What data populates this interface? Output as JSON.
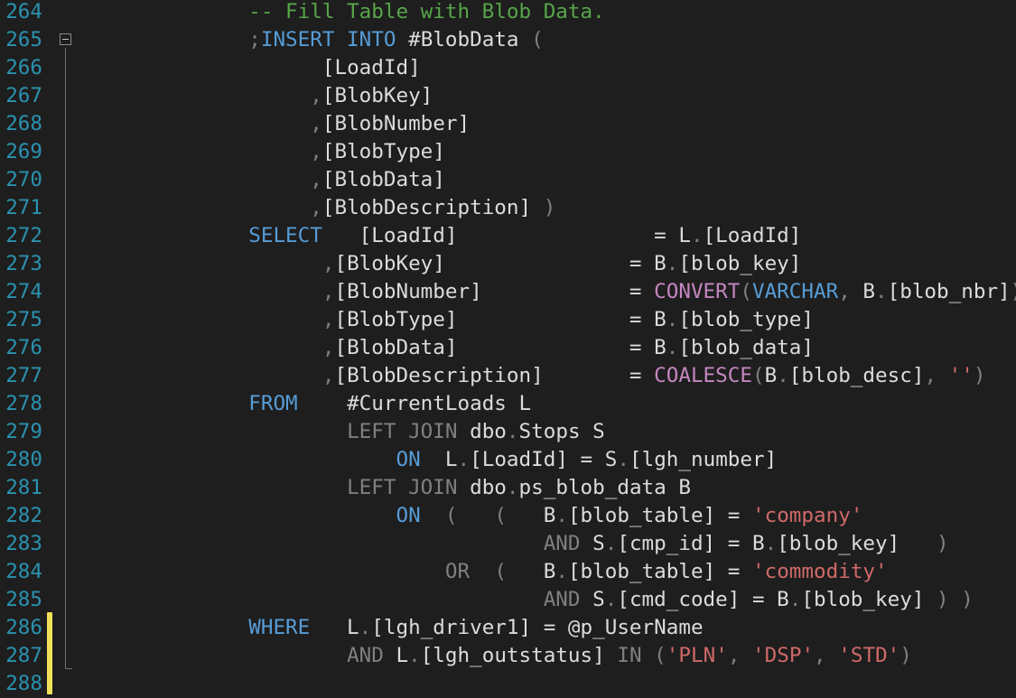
{
  "colors": {
    "background": "#1e1e1e",
    "line_number": "#2b91af",
    "keyword": "#569cd6",
    "keyword_gray": "#808080",
    "function": "#c586c0",
    "string": "#d16969",
    "comment": "#57a64a",
    "identifier": "#dcdcdc",
    "punctuation": "#808080",
    "change_bar": "#f2e05c"
  },
  "icons": {
    "fold": "collapse-minus-icon"
  },
  "lines": [
    {
      "num": "264",
      "tokens": [
        {
          "t": "            ",
          "k": "id"
        },
        {
          "t": "-- Fill Table with Blob Data.",
          "k": "cm"
        }
      ]
    },
    {
      "num": "265",
      "tokens": [
        {
          "t": "            ",
          "k": "id"
        },
        {
          "t": ";",
          "k": "pn"
        },
        {
          "t": "INSERT INTO",
          "k": "kw"
        },
        {
          "t": " #BlobData ",
          "k": "id"
        },
        {
          "t": "(",
          "k": "pn"
        }
      ]
    },
    {
      "num": "266",
      "tokens": [
        {
          "t": "                  ",
          "k": "id"
        },
        {
          "t": "[LoadId]",
          "k": "id"
        }
      ]
    },
    {
      "num": "267",
      "tokens": [
        {
          "t": "                 ",
          "k": "id"
        },
        {
          "t": ",",
          "k": "pn"
        },
        {
          "t": "[BlobKey]",
          "k": "id"
        }
      ]
    },
    {
      "num": "268",
      "tokens": [
        {
          "t": "                 ",
          "k": "id"
        },
        {
          "t": ",",
          "k": "pn"
        },
        {
          "t": "[BlobNumber]",
          "k": "id"
        }
      ]
    },
    {
      "num": "269",
      "tokens": [
        {
          "t": "                 ",
          "k": "id"
        },
        {
          "t": ",",
          "k": "pn"
        },
        {
          "t": "[BlobType]",
          "k": "id"
        }
      ]
    },
    {
      "num": "270",
      "tokens": [
        {
          "t": "                 ",
          "k": "id"
        },
        {
          "t": ",",
          "k": "pn"
        },
        {
          "t": "[BlobData]",
          "k": "id"
        }
      ]
    },
    {
      "num": "271",
      "tokens": [
        {
          "t": "                 ",
          "k": "id"
        },
        {
          "t": ",",
          "k": "pn"
        },
        {
          "t": "[BlobDescription] ",
          "k": "id"
        },
        {
          "t": ")",
          "k": "pn"
        }
      ]
    },
    {
      "num": "272",
      "tokens": [
        {
          "t": "            ",
          "k": "id"
        },
        {
          "t": "SELECT",
          "k": "kw"
        },
        {
          "t": "   [LoadId]                = ",
          "k": "id"
        },
        {
          "t": "L",
          "k": "id"
        },
        {
          "t": ".",
          "k": "pn"
        },
        {
          "t": "[LoadId]",
          "k": "id"
        }
      ]
    },
    {
      "num": "273",
      "tokens": [
        {
          "t": "                  ",
          "k": "id"
        },
        {
          "t": ",",
          "k": "pn"
        },
        {
          "t": "[BlobKey]               = B",
          "k": "id"
        },
        {
          "t": ".",
          "k": "pn"
        },
        {
          "t": "[blob_key]",
          "k": "id"
        }
      ]
    },
    {
      "num": "274",
      "tokens": [
        {
          "t": "                  ",
          "k": "id"
        },
        {
          "t": ",",
          "k": "pn"
        },
        {
          "t": "[BlobNumber]            = ",
          "k": "id"
        },
        {
          "t": "CONVERT",
          "k": "fn"
        },
        {
          "t": "(",
          "k": "pn"
        },
        {
          "t": "VARCHAR",
          "k": "kw"
        },
        {
          "t": ",",
          "k": "pn"
        },
        {
          "t": " B",
          "k": "id"
        },
        {
          "t": ".",
          "k": "pn"
        },
        {
          "t": "[blob_nbr]",
          "k": "id"
        },
        {
          "t": ")",
          "k": "pn"
        }
      ]
    },
    {
      "num": "275",
      "tokens": [
        {
          "t": "                  ",
          "k": "id"
        },
        {
          "t": ",",
          "k": "pn"
        },
        {
          "t": "[BlobType]              = B",
          "k": "id"
        },
        {
          "t": ".",
          "k": "pn"
        },
        {
          "t": "[blob_type]",
          "k": "id"
        }
      ]
    },
    {
      "num": "276",
      "tokens": [
        {
          "t": "                  ",
          "k": "id"
        },
        {
          "t": ",",
          "k": "pn"
        },
        {
          "t": "[BlobData]              = B",
          "k": "id"
        },
        {
          "t": ".",
          "k": "pn"
        },
        {
          "t": "[blob_data]",
          "k": "id"
        }
      ]
    },
    {
      "num": "277",
      "tokens": [
        {
          "t": "                  ",
          "k": "id"
        },
        {
          "t": ",",
          "k": "pn"
        },
        {
          "t": "[BlobDescription]       = ",
          "k": "id"
        },
        {
          "t": "COALESCE",
          "k": "fn"
        },
        {
          "t": "(",
          "k": "pn"
        },
        {
          "t": "B",
          "k": "id"
        },
        {
          "t": ".",
          "k": "pn"
        },
        {
          "t": "[blob_desc]",
          "k": "id"
        },
        {
          "t": ", ",
          "k": "pn"
        },
        {
          "t": "''",
          "k": "str"
        },
        {
          "t": ")",
          "k": "pn"
        }
      ]
    },
    {
      "num": "278",
      "tokens": [
        {
          "t": "            ",
          "k": "id"
        },
        {
          "t": "FROM",
          "k": "kw"
        },
        {
          "t": "    #CurrentLoads L",
          "k": "id"
        }
      ]
    },
    {
      "num": "279",
      "tokens": [
        {
          "t": "                    ",
          "k": "id"
        },
        {
          "t": "LEFT JOIN",
          "k": "kw2"
        },
        {
          "t": " dbo",
          "k": "id"
        },
        {
          "t": ".",
          "k": "pn"
        },
        {
          "t": "Stops S",
          "k": "id"
        }
      ]
    },
    {
      "num": "280",
      "tokens": [
        {
          "t": "                        ",
          "k": "id"
        },
        {
          "t": "ON",
          "k": "kw"
        },
        {
          "t": "  L",
          "k": "id"
        },
        {
          "t": ".",
          "k": "pn"
        },
        {
          "t": "[LoadId] ",
          "k": "id"
        },
        {
          "t": "=",
          "k": "id"
        },
        {
          "t": " S",
          "k": "id"
        },
        {
          "t": ".",
          "k": "pn"
        },
        {
          "t": "[lgh_number]",
          "k": "id"
        }
      ]
    },
    {
      "num": "281",
      "tokens": [
        {
          "t": "                    ",
          "k": "id"
        },
        {
          "t": "LEFT JOIN",
          "k": "kw2"
        },
        {
          "t": " dbo",
          "k": "id"
        },
        {
          "t": ".",
          "k": "pn"
        },
        {
          "t": "ps_blob_data B",
          "k": "id"
        }
      ]
    },
    {
      "num": "282",
      "tokens": [
        {
          "t": "                        ",
          "k": "id"
        },
        {
          "t": "ON",
          "k": "kw"
        },
        {
          "t": "  ",
          "k": "id"
        },
        {
          "t": "(   (",
          "k": "pn"
        },
        {
          "t": "   B",
          "k": "id"
        },
        {
          "t": ".",
          "k": "pn"
        },
        {
          "t": "[blob_table] = ",
          "k": "id"
        },
        {
          "t": "'company'",
          "k": "str"
        }
      ]
    },
    {
      "num": "283",
      "tokens": [
        {
          "t": "                                    ",
          "k": "id"
        },
        {
          "t": "AND",
          "k": "kw2"
        },
        {
          "t": " S",
          "k": "id"
        },
        {
          "t": ".",
          "k": "pn"
        },
        {
          "t": "[cmp_id] = B",
          "k": "id"
        },
        {
          "t": ".",
          "k": "pn"
        },
        {
          "t": "[blob_key]   ",
          "k": "id"
        },
        {
          "t": ")",
          "k": "pn"
        }
      ]
    },
    {
      "num": "284",
      "tokens": [
        {
          "t": "                            ",
          "k": "id"
        },
        {
          "t": "OR",
          "k": "kw2"
        },
        {
          "t": "  ",
          "k": "id"
        },
        {
          "t": "(",
          "k": "pn"
        },
        {
          "t": "   B",
          "k": "id"
        },
        {
          "t": ".",
          "k": "pn"
        },
        {
          "t": "[blob_table] = ",
          "k": "id"
        },
        {
          "t": "'commodity'",
          "k": "str"
        }
      ]
    },
    {
      "num": "285",
      "tokens": [
        {
          "t": "                                    ",
          "k": "id"
        },
        {
          "t": "AND",
          "k": "kw2"
        },
        {
          "t": " S",
          "k": "id"
        },
        {
          "t": ".",
          "k": "pn"
        },
        {
          "t": "[cmd_code] = B",
          "k": "id"
        },
        {
          "t": ".",
          "k": "pn"
        },
        {
          "t": "[blob_key] ",
          "k": "id"
        },
        {
          "t": ") )",
          "k": "pn"
        }
      ]
    },
    {
      "num": "286",
      "tokens": [
        {
          "t": "            ",
          "k": "id"
        },
        {
          "t": "WHERE",
          "k": "kw"
        },
        {
          "t": "   L",
          "k": "id"
        },
        {
          "t": ".",
          "k": "pn"
        },
        {
          "t": "[lgh_driver1] = @p_UserName",
          "k": "id"
        }
      ]
    },
    {
      "num": "287",
      "tokens": [
        {
          "t": "                    ",
          "k": "id"
        },
        {
          "t": "AND",
          "k": "kw2"
        },
        {
          "t": " L",
          "k": "id"
        },
        {
          "t": ".",
          "k": "pn"
        },
        {
          "t": "[lgh_outstatus] ",
          "k": "id"
        },
        {
          "t": "IN",
          "k": "kw2"
        },
        {
          "t": " (",
          "k": "pn"
        },
        {
          "t": "'PLN'",
          "k": "str"
        },
        {
          "t": ", ",
          "k": "pn"
        },
        {
          "t": "'DSP'",
          "k": "str"
        },
        {
          "t": ", ",
          "k": "pn"
        },
        {
          "t": "'STD'",
          "k": "str"
        },
        {
          "t": ")",
          "k": "pn"
        }
      ]
    },
    {
      "num": "288",
      "tokens": []
    }
  ]
}
